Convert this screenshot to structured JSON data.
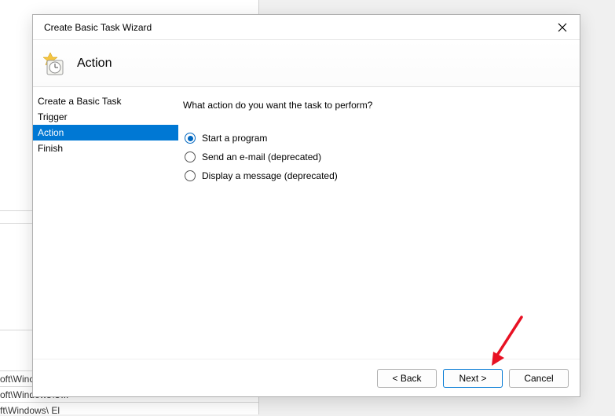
{
  "dialog": {
    "title": "Create Basic Task Wizard",
    "page_heading": "Action"
  },
  "sidebar": {
    "items": [
      {
        "label": "Create a Basic Task",
        "selected": false
      },
      {
        "label": "Trigger",
        "selected": false
      },
      {
        "label": "Action",
        "selected": true
      },
      {
        "label": "Finish",
        "selected": false
      }
    ]
  },
  "content": {
    "prompt": "What action do you want the task to perform?",
    "options": [
      {
        "label": "Start a program",
        "checked": true
      },
      {
        "label": "Send an e-mail (deprecated)",
        "checked": false
      },
      {
        "label": "Display a message (deprecated)",
        "checked": false
      }
    ]
  },
  "footer": {
    "back_label": "< Back",
    "next_label": "Next >",
    "cancel_label": "Cancel"
  },
  "background": {
    "line1": "oft\\Winc",
    "line2": "oft\\Windows\\U...",
    "line3": "ft\\Windows\\ El"
  }
}
